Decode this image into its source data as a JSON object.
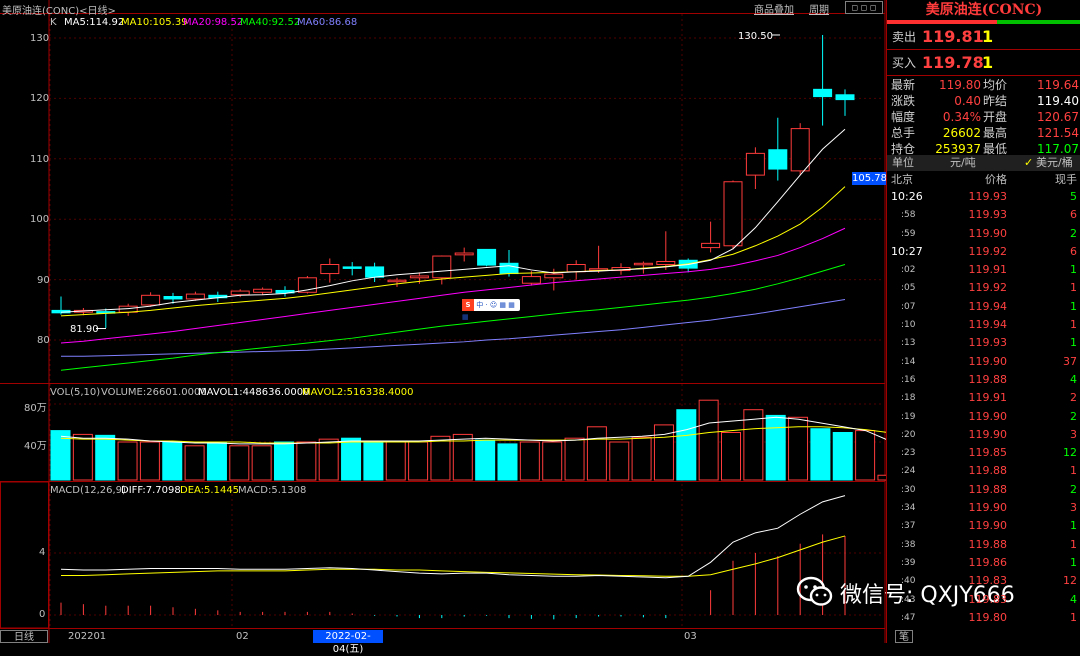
{
  "header": {
    "title": "美原油连(CONC)<日线>",
    "k_label": "K",
    "ma5": "MA5:114.92",
    "ma10": "MA10:105.39",
    "ma20": "MA20:98.52",
    "ma40": "MA40:92.52",
    "ma60": "MA60:86.68",
    "btn_overlay": "商品叠加",
    "btn_period": "周期"
  },
  "price_axis": {
    "labels": [
      "130",
      "120",
      "110",
      "100",
      "90",
      "80"
    ],
    "cursor_value": "105.78",
    "high_label": "130.50",
    "low_label": "81.90"
  },
  "volume_panel": {
    "header_vol": "VOL(5,10)",
    "header_volume": "VOLUME:26601.0000",
    "header_mavol1": "MAVOL1:448636.0000",
    "header_mavol2": "MAVOL2:516338.4000",
    "axis": [
      "80万",
      "40万"
    ]
  },
  "macd_panel": {
    "header_name": "MACD(12,26,9)",
    "header_diff": "DIFF:7.7098",
    "header_dea": "DEA:5.1445",
    "header_macd": "MACD:5.1308",
    "axis": [
      "4",
      "0"
    ]
  },
  "bottom_bar": {
    "tab": "日线",
    "date_start": "202201",
    "date_mid": "02",
    "date_selected": "2022-02-04(五)",
    "date_end": "03"
  },
  "watermark": {
    "text": "微信号: QXJY666"
  },
  "colors": {
    "up": "#ff3b3b",
    "down": "#00ffff",
    "ma5": "#ffffff",
    "ma10": "#ffff00",
    "ma20": "#ff00ff",
    "ma40": "#00ff00",
    "ma60": "#8080ff"
  },
  "side_panel": {
    "title": "美原油连(CONC)",
    "sell_label": "卖出",
    "sell_price": "119.81",
    "sell_qty": "1",
    "buy_label": "买入",
    "buy_price": "119.78",
    "buy_qty": "1",
    "stats": [
      {
        "l1": "最新",
        "v1": "119.80",
        "l2": "均价",
        "v2": "119.64"
      },
      {
        "l1": "涨跌",
        "v1": "0.40",
        "l2": "昨结",
        "v2": "119.40"
      },
      {
        "l1": "幅度",
        "v1": "0.34%",
        "l2": "开盘",
        "v2": "120.67"
      },
      {
        "l1": "总手",
        "v1": "26602",
        "l2": "最高",
        "v2": "121.54"
      },
      {
        "l1": "持仓",
        "v1": "253937",
        "l2": "最低",
        "v2": "117.07"
      }
    ],
    "unit_label": "单位",
    "unit_value": "元/吨",
    "unit_alt": "美元/桶",
    "ticks_header": {
      "time": "北京",
      "price": "价格",
      "vol": "现手"
    },
    "ticks": [
      {
        "t": "10:26",
        "p": "119.93",
        "v": "5"
      },
      {
        "t": ":58",
        "p": "119.93",
        "v": "6"
      },
      {
        "t": ":59",
        "p": "119.90",
        "v": "2"
      },
      {
        "t": "10:27",
        "p": "119.92",
        "v": "6"
      },
      {
        "t": ":02",
        "p": "119.91",
        "v": "1"
      },
      {
        "t": ":05",
        "p": "119.92",
        "v": "1"
      },
      {
        "t": ":07",
        "p": "119.94",
        "v": "1"
      },
      {
        "t": ":10",
        "p": "119.94",
        "v": "1"
      },
      {
        "t": ":13",
        "p": "119.93",
        "v": "1"
      },
      {
        "t": ":14",
        "p": "119.90",
        "v": "37"
      },
      {
        "t": ":16",
        "p": "119.88",
        "v": "4"
      },
      {
        "t": ":18",
        "p": "119.91",
        "v": "2"
      },
      {
        "t": ":19",
        "p": "119.90",
        "v": "2"
      },
      {
        "t": ":20",
        "p": "119.90",
        "v": "3"
      },
      {
        "t": ":23",
        "p": "119.85",
        "v": "12"
      },
      {
        "t": ":24",
        "p": "119.88",
        "v": "1"
      },
      {
        "t": ":30",
        "p": "119.88",
        "v": "2"
      },
      {
        "t": ":34",
        "p": "119.90",
        "v": "3"
      },
      {
        "t": ":37",
        "p": "119.90",
        "v": "1"
      },
      {
        "t": ":38",
        "p": "119.88",
        "v": "1"
      },
      {
        "t": ":39",
        "p": "119.86",
        "v": "1"
      },
      {
        "t": ":40",
        "p": "119.83",
        "v": "12"
      },
      {
        "t": ":43",
        "p": "119.83",
        "v": "4"
      },
      {
        "t": ":47",
        "p": "119.80",
        "v": "1"
      }
    ],
    "footer_tab": "笔"
  },
  "chart_data": {
    "type": "candlestick",
    "candles": [
      {
        "o": 84.9,
        "c": 84.5,
        "h": 87.2,
        "l": 84.2
      },
      {
        "o": 84.6,
        "c": 84.9,
        "h": 85.3,
        "l": 84.1
      },
      {
        "o": 84.7,
        "c": 84.5,
        "h": 85.2,
        "l": 82.0
      },
      {
        "o": 84.6,
        "c": 85.6,
        "h": 86.0,
        "l": 84.0
      },
      {
        "o": 85.8,
        "c": 87.4,
        "h": 87.9,
        "l": 85.5
      },
      {
        "o": 87.2,
        "c": 86.8,
        "h": 87.8,
        "l": 86.0
      },
      {
        "o": 86.8,
        "c": 87.6,
        "h": 88.0,
        "l": 86.5
      },
      {
        "o": 87.4,
        "c": 87.0,
        "h": 88.0,
        "l": 86.3
      },
      {
        "o": 87.5,
        "c": 88.1,
        "h": 88.4,
        "l": 87.1
      },
      {
        "o": 87.9,
        "c": 88.4,
        "h": 88.7,
        "l": 87.5
      },
      {
        "o": 88.2,
        "c": 87.8,
        "h": 88.9,
        "l": 87.2
      },
      {
        "o": 87.9,
        "c": 90.3,
        "h": 90.6,
        "l": 87.7
      },
      {
        "o": 91.0,
        "c": 92.5,
        "h": 93.5,
        "l": 89.5
      },
      {
        "o": 92.1,
        "c": 92.0,
        "h": 92.9,
        "l": 90.7
      },
      {
        "o": 92.1,
        "c": 90.4,
        "h": 92.8,
        "l": 89.6
      },
      {
        "o": 89.9,
        "c": 89.9,
        "h": 90.3,
        "l": 88.8
      },
      {
        "o": 90.3,
        "c": 90.6,
        "h": 91.2,
        "l": 89.3
      },
      {
        "o": 90.3,
        "c": 93.9,
        "h": 94.0,
        "l": 89.2
      },
      {
        "o": 94.1,
        "c": 94.4,
        "h": 95.3,
        "l": 93.0
      },
      {
        "o": 95.0,
        "c": 92.4,
        "h": 95.0,
        "l": 92.2
      },
      {
        "o": 92.7,
        "c": 91.0,
        "h": 94.9,
        "l": 90.5
      },
      {
        "o": 89.4,
        "c": 90.5,
        "h": 91.4,
        "l": 89.0
      },
      {
        "o": 90.3,
        "c": 90.9,
        "h": 91.8,
        "l": 88.2
      },
      {
        "o": 91.3,
        "c": 92.5,
        "h": 93.2,
        "l": 90.0
      },
      {
        "o": 91.6,
        "c": 91.8,
        "h": 95.6,
        "l": 91.1
      },
      {
        "o": 91.5,
        "c": 92.0,
        "h": 92.7,
        "l": 90.8
      },
      {
        "o": 92.5,
        "c": 92.7,
        "h": 93.0,
        "l": 91.0
      },
      {
        "o": 92.5,
        "c": 93.0,
        "h": 98.0,
        "l": 91.6
      },
      {
        "o": 93.2,
        "c": 91.9,
        "h": 93.5,
        "l": 91.2
      },
      {
        "o": 95.3,
        "c": 96.0,
        "h": 99.6,
        "l": 94.5
      },
      {
        "o": 95.6,
        "c": 106.2,
        "h": 106.4,
        "l": 95.0
      },
      {
        "o": 107.3,
        "c": 110.9,
        "h": 111.9,
        "l": 105.0
      },
      {
        "o": 111.5,
        "c": 108.3,
        "h": 116.8,
        "l": 106.4
      },
      {
        "o": 108.0,
        "c": 115.0,
        "h": 115.9,
        "l": 107.3
      },
      {
        "o": 121.5,
        "c": 120.3,
        "h": 130.5,
        "l": 115.5
      },
      {
        "o": 120.6,
        "c": 119.8,
        "h": 121.5,
        "l": 117.1
      }
    ],
    "ma5": [
      84.6,
      84.8,
      85.0,
      85.2,
      85.6,
      86.2,
      86.6,
      87.0,
      87.4,
      87.5,
      87.7,
      88.3,
      89.0,
      89.8,
      90.4,
      90.8,
      91.1,
      91.4,
      91.7,
      92.0,
      92.3,
      91.6,
      91.1,
      91.3,
      91.4,
      91.6,
      91.8,
      92.1,
      92.5,
      93.2,
      95.1,
      98.6,
      102.9,
      107.3,
      111.6,
      114.9
    ],
    "ma10": [
      84.0,
      84.2,
      84.4,
      84.6,
      84.9,
      85.3,
      85.7,
      86.0,
      86.3,
      86.6,
      86.9,
      87.3,
      87.8,
      88.3,
      88.8,
      89.3,
      89.7,
      90.1,
      90.4,
      90.7,
      91.0,
      91.1,
      91.2,
      91.3,
      91.5,
      91.6,
      91.9,
      92.2,
      92.6,
      93.3,
      94.2,
      95.6,
      97.2,
      99.2,
      102.0,
      105.4
    ],
    "ma20": [
      79.5,
      79.8,
      80.2,
      80.6,
      81.0,
      81.4,
      81.9,
      82.4,
      82.9,
      83.4,
      83.9,
      84.4,
      84.9,
      85.4,
      85.9,
      86.4,
      86.9,
      87.4,
      87.9,
      88.3,
      88.7,
      89.1,
      89.5,
      89.8,
      90.1,
      90.4,
      90.7,
      91.0,
      91.3,
      91.7,
      92.3,
      93.1,
      94.0,
      95.3,
      96.8,
      98.5
    ],
    "ma40": [
      75.0,
      75.4,
      75.8,
      76.2,
      76.6,
      77.0,
      77.5,
      77.9,
      78.3,
      78.7,
      79.1,
      79.5,
      79.9,
      80.3,
      80.8,
      81.3,
      81.8,
      82.3,
      82.7,
      83.1,
      83.5,
      83.9,
      84.3,
      84.7,
      85.0,
      85.4,
      85.8,
      86.2,
      86.6,
      87.1,
      87.7,
      88.4,
      89.3,
      90.3,
      91.4,
      92.5
    ],
    "ma60": [
      77.3,
      77.3,
      77.4,
      77.5,
      77.6,
      77.7,
      77.8,
      77.9,
      78.0,
      78.1,
      78.2,
      78.3,
      78.5,
      78.7,
      78.9,
      79.1,
      79.3,
      79.5,
      79.7,
      80.0,
      80.2,
      80.5,
      80.8,
      81.1,
      81.4,
      81.7,
      82.1,
      82.5,
      82.9,
      83.3,
      83.8,
      84.3,
      84.9,
      85.5,
      86.1,
      86.7
    ],
    "volume": [
      52,
      48,
      47,
      40,
      40,
      40,
      36,
      40,
      36,
      36,
      40,
      40,
      43,
      44,
      40,
      40,
      40,
      46,
      48,
      42,
      38,
      40,
      40,
      44,
      56,
      40,
      45,
      58,
      74,
      84,
      50,
      74,
      68,
      66,
      54,
      50,
      52,
      5
    ],
    "mavol1": [
      46,
      44,
      44,
      43,
      41,
      40,
      39,
      39,
      38,
      38,
      38,
      39,
      40,
      41,
      41,
      41,
      41,
      42,
      43,
      44,
      43,
      42,
      41,
      42,
      44,
      45,
      46,
      48,
      53,
      60,
      62,
      64,
      66,
      64,
      60,
      56,
      52,
      42
    ],
    "mavol2": [
      44,
      43,
      43,
      42,
      41,
      41,
      40,
      40,
      40,
      39,
      39,
      39,
      39,
      40,
      40,
      40,
      40,
      41,
      41,
      42,
      42,
      42,
      42,
      42,
      43,
      43,
      44,
      45,
      47,
      50,
      52,
      54,
      55,
      56,
      56,
      55,
      53,
      50
    ],
    "diff": [
      2.95,
      2.9,
      2.9,
      2.95,
      3.0,
      3.0,
      3.0,
      3.0,
      2.95,
      2.95,
      2.95,
      3.0,
      3.05,
      3.0,
      2.9,
      2.8,
      2.7,
      2.65,
      2.7,
      2.7,
      2.6,
      2.55,
      2.5,
      2.5,
      2.55,
      2.5,
      2.45,
      2.4,
      2.5,
      3.4,
      4.7,
      5.3,
      5.6,
      6.5,
      7.3,
      7.7
    ],
    "dea": [
      2.55,
      2.55,
      2.6,
      2.65,
      2.7,
      2.75,
      2.8,
      2.85,
      2.85,
      2.85,
      2.85,
      2.9,
      2.95,
      2.95,
      2.95,
      2.9,
      2.9,
      2.85,
      2.8,
      2.75,
      2.72,
      2.68,
      2.64,
      2.6,
      2.58,
      2.55,
      2.53,
      2.5,
      2.5,
      2.6,
      2.95,
      3.3,
      3.7,
      4.2,
      4.7,
      5.1
    ],
    "macd": [
      0.8,
      0.7,
      0.6,
      0.6,
      0.6,
      0.5,
      0.4,
      0.3,
      0.2,
      0.2,
      0.2,
      0.2,
      0.2,
      0.1,
      -0.05,
      -0.1,
      -0.2,
      -0.2,
      -0.1,
      -0.05,
      -0.2,
      -0.25,
      -0.28,
      -0.2,
      -0.1,
      -0.1,
      -0.15,
      -0.2,
      0.0,
      1.6,
      3.5,
      4.0,
      3.8,
      4.6,
      5.2,
      5.1
    ],
    "y_axis_price": [
      80,
      130
    ],
    "y_axis_volume": [
      "0",
      "80万"
    ],
    "y_axis_macd": [
      0,
      4
    ]
  }
}
